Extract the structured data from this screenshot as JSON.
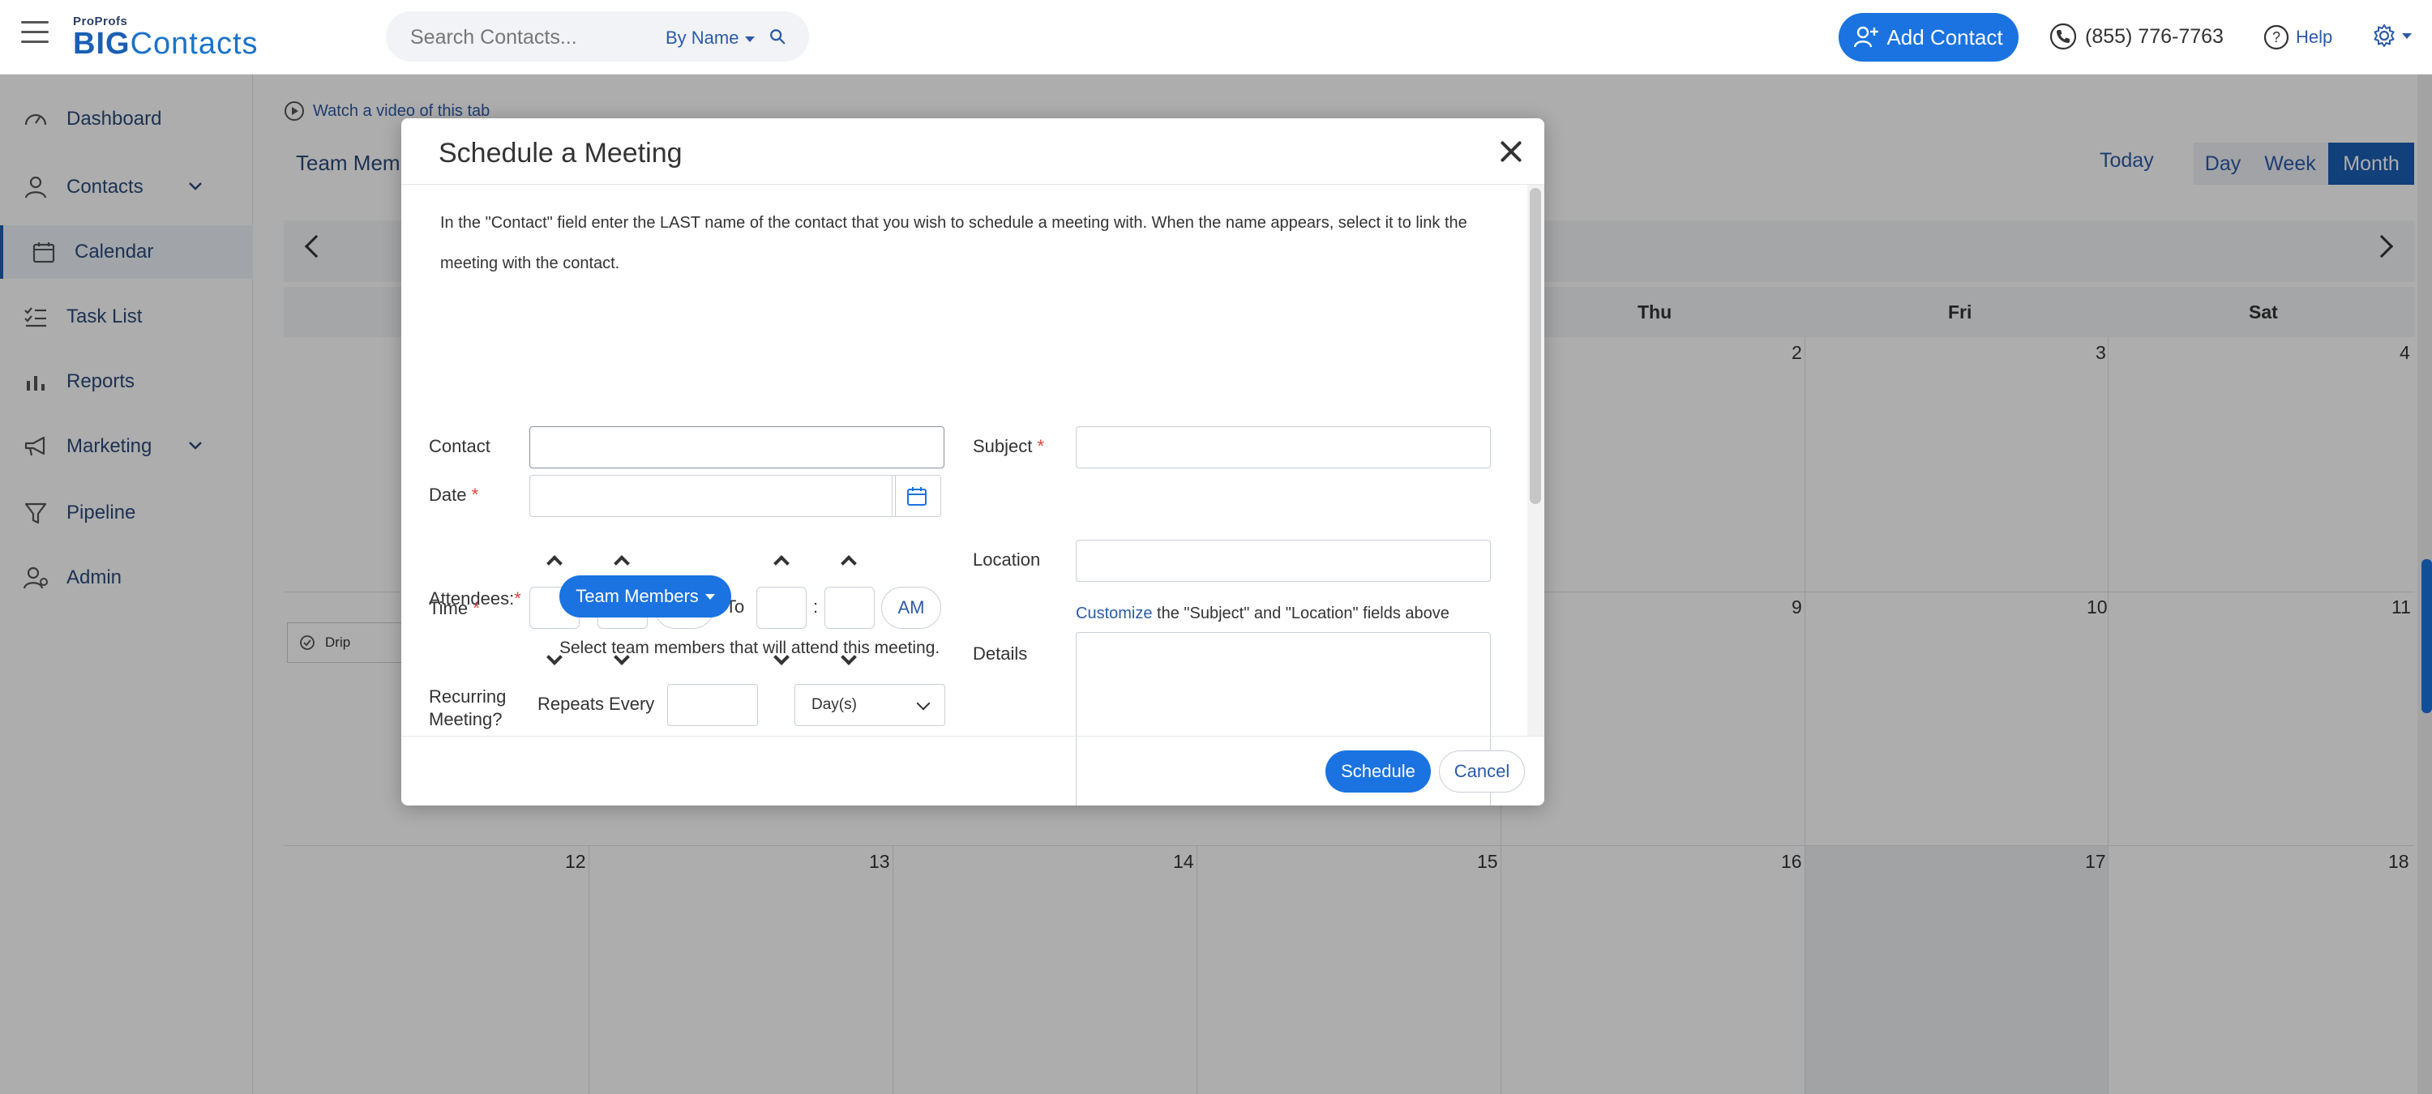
{
  "header": {
    "logo_small": "ProProfs",
    "logo_big_bold": "BIG",
    "logo_big_rest": "Contacts",
    "search_placeholder": "Search Contacts...",
    "search_by": "By Name",
    "add_contact": "Add Contact",
    "phone": "(855) 776-7763",
    "help": "Help"
  },
  "sidebar": {
    "items": [
      {
        "label": "Dashboard",
        "icon": "speedometer-icon"
      },
      {
        "label": "Contacts",
        "icon": "user-icon"
      },
      {
        "label": "Calendar",
        "icon": "calendar-icon"
      },
      {
        "label": "Task List",
        "icon": "checklist-icon"
      },
      {
        "label": "Reports",
        "icon": "bar-chart-icon"
      },
      {
        "label": "Marketing",
        "icon": "megaphone-icon"
      },
      {
        "label": "Pipeline",
        "icon": "funnel-icon"
      },
      {
        "label": "Admin",
        "icon": "admin-user-icon"
      }
    ]
  },
  "calendar": {
    "video_link": "Watch a video of this tab",
    "team_label": "Team Memb",
    "today": "Today",
    "views": [
      "Day",
      "Week",
      "Month"
    ],
    "active_view": "Month",
    "days_of_week": [
      "Thu",
      "Fri",
      "Sat"
    ],
    "week1_numbers": [
      "2",
      "3",
      "4"
    ],
    "week2_numbers": [
      "9",
      "10",
      "11"
    ],
    "week3_numbers": [
      "12",
      "13",
      "14",
      "15",
      "16",
      "17",
      "18"
    ],
    "event_label": "Drip"
  },
  "modal": {
    "title": "Schedule a Meeting",
    "instructions": "In the \"Contact\" field enter the LAST name of the contact that you wish to schedule a meeting with. When the name appears, select it to link the meeting with the contact.",
    "contact_label": "Contact",
    "date_label": "Date",
    "time_label": "Time",
    "am_label": "AM",
    "to_label": "To",
    "colon": ":",
    "required_mark": "*",
    "attendees_label": "Attendees:",
    "team_members_btn": "Team Members",
    "attendees_hint": "Select team members that will attend this meeting.",
    "recurring_label_1": "Recurring",
    "recurring_label_2": "Meeting?",
    "repeats_every": "Repeats Every",
    "repeat_unit": "Day(s)",
    "subject_label": "Subject",
    "location_label": "Location",
    "customize_link": "Customize",
    "customize_text": " the \"Subject\" and \"Location\" fields above",
    "details_label": "Details",
    "schedule_btn": "Schedule",
    "cancel_btn": "Cancel"
  },
  "colors": {
    "primary": "#1a73e0",
    "nav_text": "#2c4a7a",
    "required": "#e0443b"
  }
}
